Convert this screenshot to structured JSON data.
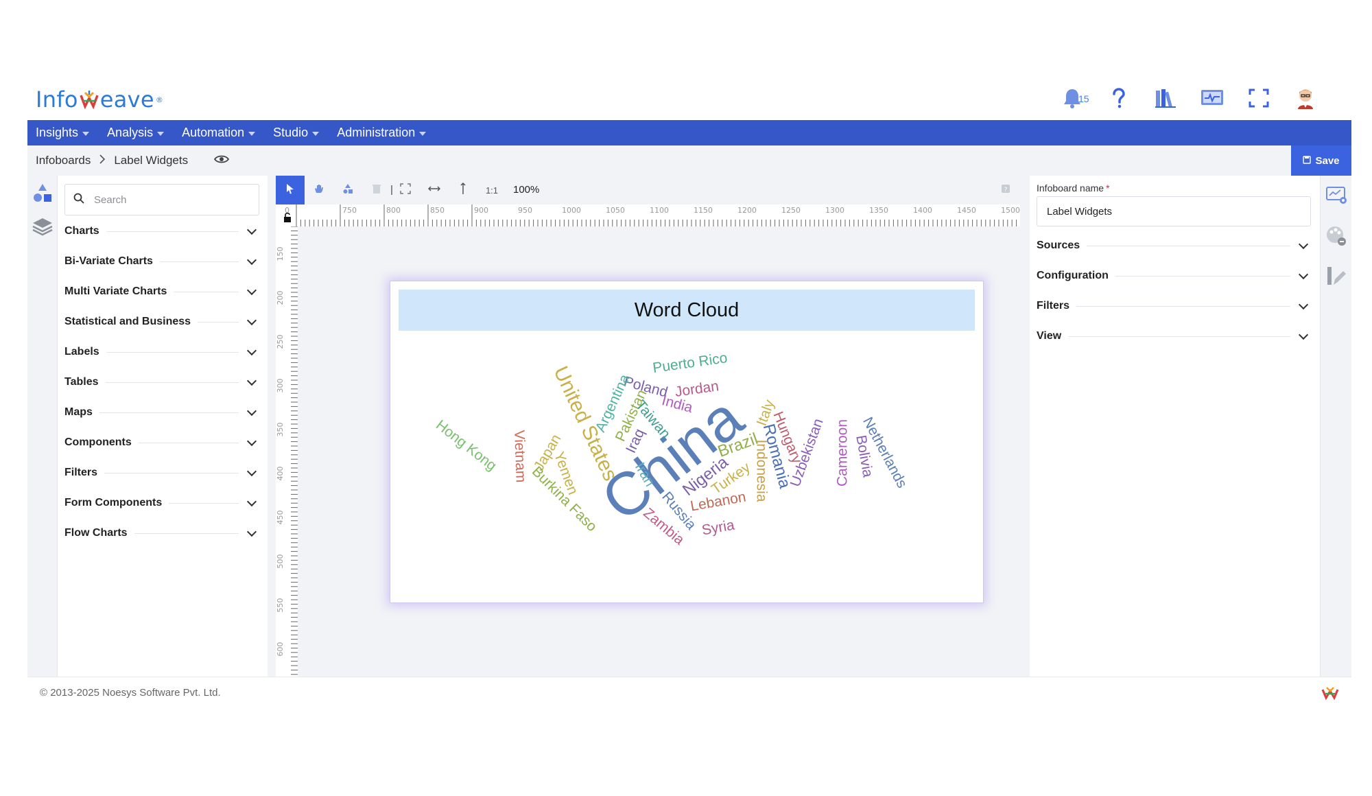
{
  "brand": {
    "name_left": "Info",
    "name_right": "eave",
    "trademark": "®"
  },
  "header": {
    "notification_count": "15"
  },
  "nav": {
    "items": [
      {
        "label": "Insights"
      },
      {
        "label": "Analysis"
      },
      {
        "label": "Automation"
      },
      {
        "label": "Studio"
      },
      {
        "label": "Administration"
      }
    ]
  },
  "breadcrumb": {
    "root": "Infoboards",
    "current": "Label Widgets"
  },
  "toolbar": {
    "save_label": "Save",
    "zoom": "100%",
    "ratio_label": "1:1"
  },
  "panel": {
    "search_placeholder": "Search",
    "sections": [
      {
        "label": "Charts"
      },
      {
        "label": "Bi-Variate Charts"
      },
      {
        "label": "Multi Variate Charts"
      },
      {
        "label": "Statistical and Business"
      },
      {
        "label": "Labels"
      },
      {
        "label": "Tables"
      },
      {
        "label": "Maps"
      },
      {
        "label": "Components"
      },
      {
        "label": "Filters"
      },
      {
        "label": "Form Components"
      },
      {
        "label": "Flow Charts"
      }
    ]
  },
  "ruler": {
    "top_labels": [
      "0",
      "750",
      "800",
      "850",
      "900",
      "950",
      "1000",
      "1050",
      "1100",
      "1150",
      "1200",
      "1250",
      "1300",
      "1350",
      "1400",
      "1450",
      "1500"
    ],
    "left_labels": [
      "150",
      "200",
      "250",
      "300",
      "350",
      "400",
      "450",
      "500",
      "550",
      "600"
    ]
  },
  "widget": {
    "title": "Word Cloud",
    "words": [
      {
        "text": "China",
        "color": "#5b7fb8",
        "size": 88
      },
      {
        "text": "United States",
        "color": "#c9b14a",
        "size": 30
      },
      {
        "text": "Puerto Rico",
        "color": "#4fae8e",
        "size": 21
      },
      {
        "text": "Poland",
        "color": "#7a5ea8",
        "size": 21
      },
      {
        "text": "Jordan",
        "color": "#b85b8c",
        "size": 21
      },
      {
        "text": "India",
        "color": "#b05bc0",
        "size": 21
      },
      {
        "text": "Argentina",
        "color": "#4fb3a3",
        "size": 21
      },
      {
        "text": "Pakistan",
        "color": "#8fb04a",
        "size": 21
      },
      {
        "text": "Taiwan",
        "color": "#3f9e8f",
        "size": 21
      },
      {
        "text": "Iraq",
        "color": "#7a5ea8",
        "size": 21
      },
      {
        "text": "Hong Kong",
        "color": "#7ac06f",
        "size": 21
      },
      {
        "text": "Vietnam",
        "color": "#d06a5a",
        "size": 21
      },
      {
        "text": "Japan",
        "color": "#c9b14a",
        "size": 21
      },
      {
        "text": "Yemen",
        "color": "#c9b14a",
        "size": 21
      },
      {
        "text": "Burkina Faso",
        "color": "#8fb04a",
        "size": 21
      },
      {
        "text": "Iran",
        "color": "#5bb0c0",
        "size": 21
      },
      {
        "text": "Nigeria",
        "color": "#7a5ea8",
        "size": 24
      },
      {
        "text": "Brazil",
        "color": "#8fb04a",
        "size": 24
      },
      {
        "text": "Turkey",
        "color": "#c9b14a",
        "size": 21
      },
      {
        "text": "Russia",
        "color": "#5b7fb8",
        "size": 21
      },
      {
        "text": "Lebanon",
        "color": "#c06a55",
        "size": 21
      },
      {
        "text": "Zambia",
        "color": "#c05b8c",
        "size": 21
      },
      {
        "text": "Syria",
        "color": "#b05b90",
        "size": 21
      },
      {
        "text": "Italy",
        "color": "#c9b14a",
        "size": 21
      },
      {
        "text": "Hungary",
        "color": "#c05b6c",
        "size": 21
      },
      {
        "text": "Romania",
        "color": "#4a6fb8",
        "size": 24
      },
      {
        "text": "Indonesia",
        "color": "#c9a04a",
        "size": 21
      },
      {
        "text": "Uzbekistan",
        "color": "#8a5eb8",
        "size": 21
      },
      {
        "text": "Cameroon",
        "color": "#b05bc0",
        "size": 21
      },
      {
        "text": "Bolivia",
        "color": "#8a5eb8",
        "size": 21
      },
      {
        "text": "Netherlands",
        "color": "#5b7fb8",
        "size": 21
      }
    ]
  },
  "properties": {
    "name_label": "Infoboard name",
    "name_value": "Label Widgets",
    "sections": [
      {
        "label": "Sources"
      },
      {
        "label": "Configuration"
      },
      {
        "label": "Filters"
      },
      {
        "label": "View"
      }
    ]
  },
  "footer": {
    "copyright": "© 2013-2025 Noesys Software Pvt. Ltd."
  },
  "colors": {
    "nav": "#3557c8",
    "primary": "#3b63e0",
    "title_band": "#cfe6fb"
  }
}
